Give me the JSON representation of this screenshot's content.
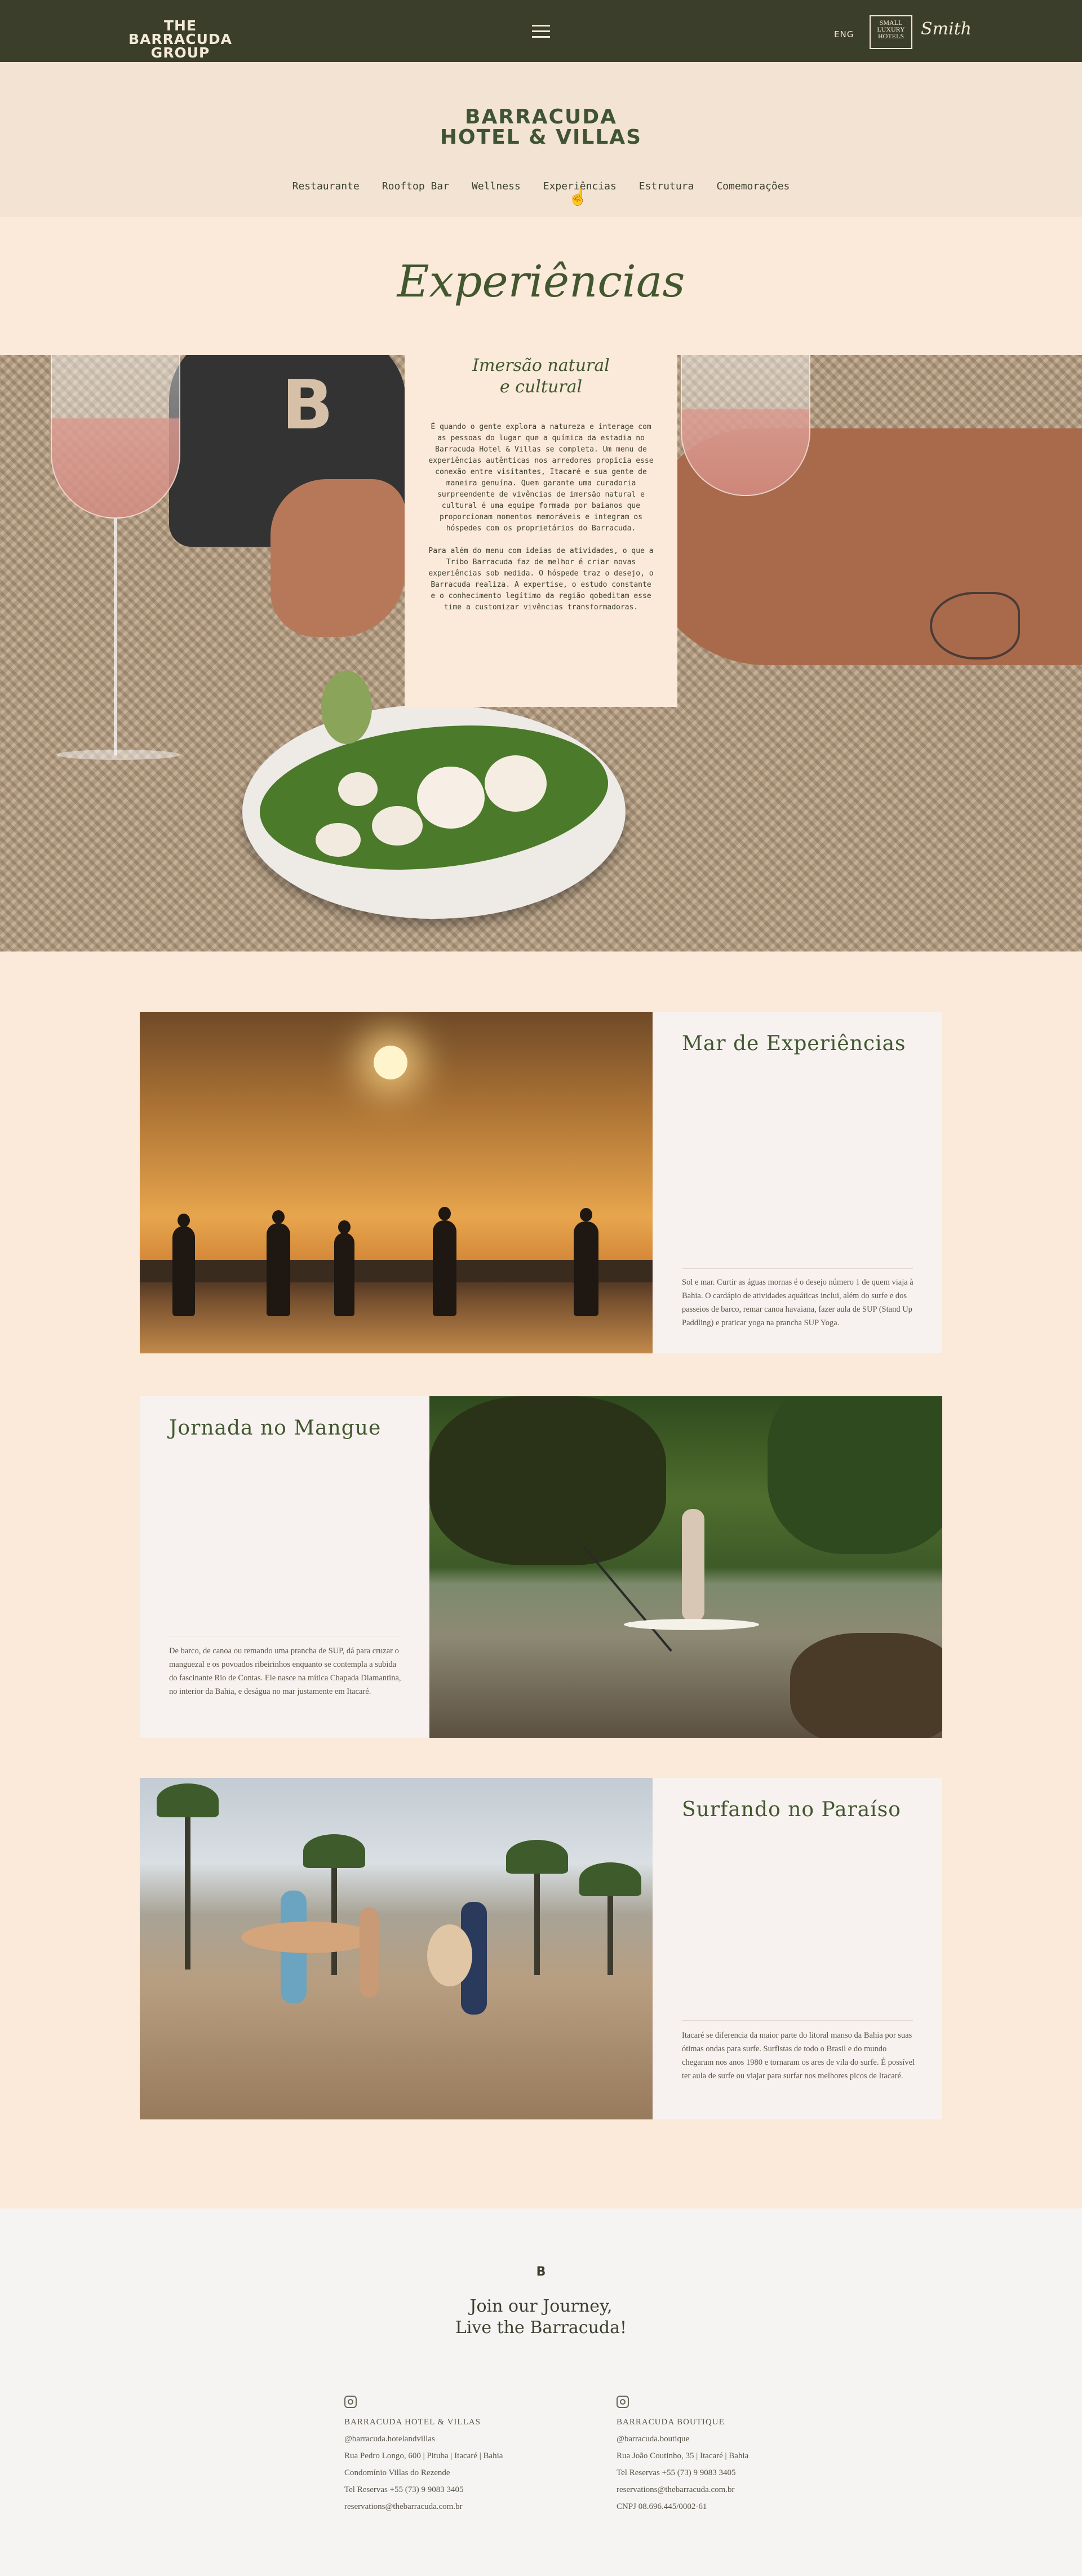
{
  "topbar": {
    "logo_line1": "THE BARRACUDA",
    "logo_line2": "GROUP",
    "menu_icon": "hamburger-icon",
    "lang": "ENG",
    "slh_badge": "SMALL LUXURY HOTELS",
    "smith_badge": "Smith",
    "bg_color": "#3b3e2b"
  },
  "header": {
    "brand_line1": "BARRACUDA",
    "brand_line2": "HOTEL & VILLAS",
    "nav": [
      "Restaurante",
      "Rooftop Bar",
      "Wellness",
      "Experiências",
      "Estrutura",
      "Comemorações"
    ]
  },
  "page": {
    "title": "Experiências"
  },
  "hero": {
    "heading_line1": "Imersão natural",
    "heading_line2": "e cultural",
    "paragraph1": "É quando o gente explora a natureza e interage com as pessoas do lugar que a química da estadia no Barracuda Hotel & Villas se completa. Um menu de experiências autênticas nos arredores propicia esse conexão entre visitantes, Itacaré e sua gente de maneira genuína. Quem garante uma curadoria surpreendente de vivências de imersão natural e cultural é uma equipe formada por baianos que proporcionam momentos memoráveis e integram os hóspedes com os proprietários do Barracuda.",
    "paragraph2": "Para além do menu com ideias de atividades, o que a Tribo Barracuda faz de melhor é criar novas experiências sob medida. O hóspede traz o desejo, o Barracuda realiza. A expertise, o estudo constante e o conhecimento legítimo da região qobeditam esse time a customizar vivências transformadoras."
  },
  "experiences": [
    {
      "title": "Mar de Experiências",
      "text": "Sol e mar. Curtir as águas mornas é o desejo número 1 de quem viaja à Bahia. O cardápio de atividades aquáticas inclui, além do surfe e dos passeios de barco, remar canoa havaiana, fazer aula de SUP (Stand Up Paddling) e praticar yoga na prancha SUP Yoga."
    },
    {
      "title": "Jornada no Mangue",
      "text": "De barco, de canoa ou remando uma prancha de SUP, dá para cruzar o manguezal e os povoados ribeirinhos enquanto se contempla a subida do fascinante Rio de Contas. Ele nasce na mítica Chapada Diamantina, no interior da Bahia, e deságua no mar justamente em Itacaré."
    },
    {
      "title": "Surfando no Paraíso",
      "text": "Itacaré se diferencia da maior parte do litoral manso da Bahia por suas ótimas ondas para surfe. Surfistas de todo o Brasil e do mundo chegaram nos anos 1980 e tornaram os ares de vila do surfe. É possível ter aula de surfe ou viajar para surfar nos melhores picos de Itacaré."
    }
  ],
  "footer": {
    "logo": "B",
    "title_line1": "Join our Journey,",
    "title_line2": "Live the Barracuda!",
    "col1": {
      "name": "BARRACUDA HOTEL & VILLAS",
      "handle": "@barracuda.hotelandvillas",
      "address": "Rua Pedro Longo, 600 | Pituba | Itacaré | Bahia",
      "condo": "Condomínio Villas do Rezende",
      "phone": "Tel Reservas +55 (73) 9 9083 3405",
      "email": "reservations@thebarracuda.com.br"
    },
    "col2": {
      "name": "BARRACUDA BOUTIQUE",
      "handle": "@barracuda.boutique",
      "address": "Rua João Coutinho, 35 | Itacaré | Bahia",
      "phone": "Tel Reservas +55 (73) 9 9083 3405",
      "email": "reservations@thebarracuda.com.br",
      "cnpj": "CNPJ 08.696.445/0002-61"
    }
  },
  "colors": {
    "page_bg": "#fbe9d9",
    "accent_green": "#41572f",
    "panel_bg": "#f7f2ef",
    "footer_bg": "#f5f4f2"
  }
}
